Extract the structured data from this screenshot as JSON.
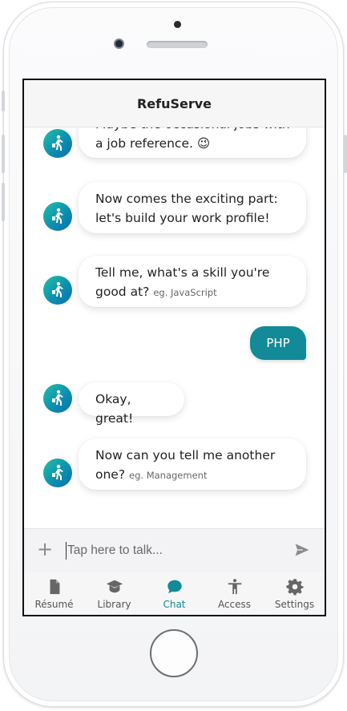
{
  "app": {
    "title": "RefuServe"
  },
  "chat": {
    "messages": [
      {
        "from": "bot",
        "text": "Maybe the occasional jobs with a job reference. 😉",
        "hint": ""
      },
      {
        "from": "bot",
        "text": "Now comes the exciting part: let's build your work profile!",
        "hint": ""
      },
      {
        "from": "bot",
        "text": "Tell me, what's a skill you're good at?",
        "hint": "eg. JavaScript"
      },
      {
        "from": "user",
        "text": "PHP",
        "hint": ""
      },
      {
        "from": "bot",
        "text": "Okay, great!",
        "hint": ""
      },
      {
        "from": "bot",
        "text": "Now can you tell me another one?",
        "hint": "eg. Management"
      }
    ]
  },
  "composer": {
    "placeholder": "Tap here to talk...",
    "add_icon": "plus-icon",
    "send_icon": "send-icon"
  },
  "tabs": [
    {
      "label": "Résumé",
      "icon": "document-icon",
      "active": false
    },
    {
      "label": "Library",
      "icon": "graduation-cap-icon",
      "active": false
    },
    {
      "label": "Chat",
      "icon": "chat-bubble-icon",
      "active": true
    },
    {
      "label": "Access",
      "icon": "accessibility-icon",
      "active": false
    },
    {
      "label": "Settings",
      "icon": "gear-icon",
      "active": false
    }
  ],
  "colors": {
    "accent": "#138a98",
    "avatar_start": "#22c0a6",
    "avatar_end": "#0b6fae"
  }
}
